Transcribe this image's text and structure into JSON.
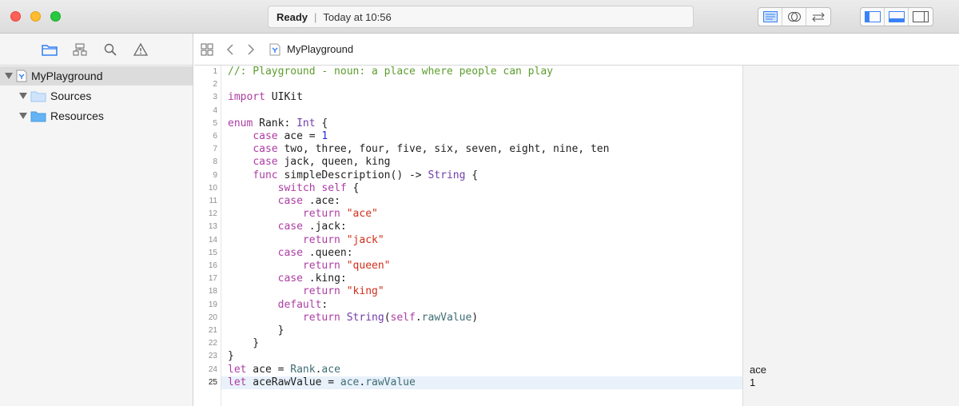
{
  "window": {
    "status": {
      "state": "Ready",
      "separator": "|",
      "time": "Today at 10:56"
    }
  },
  "toolbar": {
    "editor_modes": [
      {
        "icon": "standard-editor-icon"
      },
      {
        "icon": "assistant-editor-icon"
      },
      {
        "icon": "version-editor-icon"
      }
    ],
    "view_toggles": [
      {
        "icon": "navigator-toggle-icon"
      },
      {
        "icon": "debug-area-toggle-icon"
      },
      {
        "icon": "utilities-toggle-icon"
      }
    ]
  },
  "navigator": {
    "tabs": [
      {
        "icon": "folder-icon"
      },
      {
        "icon": "hierarchy-icon"
      },
      {
        "icon": "search-icon"
      },
      {
        "icon": "warning-icon"
      }
    ],
    "tree": [
      {
        "label": "MyPlayground",
        "kind": "playground",
        "selected": true
      },
      {
        "label": "Sources",
        "kind": "folder-light"
      },
      {
        "label": "Resources",
        "kind": "folder"
      }
    ]
  },
  "jumpbar": {
    "file": "MyPlayground"
  },
  "editor": {
    "lines": [
      [
        [
          "com",
          "//: Playground - noun: a place where people can play"
        ]
      ],
      [],
      [
        [
          "kw",
          "import"
        ],
        [
          "",
          " UIKit"
        ]
      ],
      [],
      [
        [
          "kw",
          "enum"
        ],
        [
          "",
          " Rank: "
        ],
        [
          "typ",
          "Int"
        ],
        [
          "",
          " {"
        ]
      ],
      [
        [
          "",
          "    "
        ],
        [
          "kw",
          "case"
        ],
        [
          "",
          " ace = "
        ],
        [
          "num",
          "1"
        ]
      ],
      [
        [
          "",
          "    "
        ],
        [
          "kw",
          "case"
        ],
        [
          "",
          " two, three, four, five, six, seven, eight, nine, ten"
        ]
      ],
      [
        [
          "",
          "    "
        ],
        [
          "kw",
          "case"
        ],
        [
          "",
          " jack, queen, king"
        ]
      ],
      [
        [
          "",
          "    "
        ],
        [
          "kw",
          "func"
        ],
        [
          "",
          " simpleDescription() -> "
        ],
        [
          "typ",
          "String"
        ],
        [
          "",
          " {"
        ]
      ],
      [
        [
          "",
          "        "
        ],
        [
          "kw",
          "switch"
        ],
        [
          "",
          " "
        ],
        [
          "kw",
          "self"
        ],
        [
          "",
          " {"
        ]
      ],
      [
        [
          "",
          "        "
        ],
        [
          "kw",
          "case"
        ],
        [
          "",
          " .ace:"
        ]
      ],
      [
        [
          "",
          "            "
        ],
        [
          "kw",
          "return"
        ],
        [
          "",
          " "
        ],
        [
          "str",
          "\"ace\""
        ]
      ],
      [
        [
          "",
          "        "
        ],
        [
          "kw",
          "case"
        ],
        [
          "",
          " .jack:"
        ]
      ],
      [
        [
          "",
          "            "
        ],
        [
          "kw",
          "return"
        ],
        [
          "",
          " "
        ],
        [
          "str",
          "\"jack\""
        ]
      ],
      [
        [
          "",
          "        "
        ],
        [
          "kw",
          "case"
        ],
        [
          "",
          " .queen:"
        ]
      ],
      [
        [
          "",
          "            "
        ],
        [
          "kw",
          "return"
        ],
        [
          "",
          " "
        ],
        [
          "str",
          "\"queen\""
        ]
      ],
      [
        [
          "",
          "        "
        ],
        [
          "kw",
          "case"
        ],
        [
          "",
          " .king:"
        ]
      ],
      [
        [
          "",
          "            "
        ],
        [
          "kw",
          "return"
        ],
        [
          "",
          " "
        ],
        [
          "str",
          "\"king\""
        ]
      ],
      [
        [
          "",
          "        "
        ],
        [
          "kw",
          "default"
        ],
        [
          "",
          ":"
        ]
      ],
      [
        [
          "",
          "            "
        ],
        [
          "kw",
          "return"
        ],
        [
          "",
          " "
        ],
        [
          "typ",
          "String"
        ],
        [
          "",
          "("
        ],
        [
          "kw",
          "self"
        ],
        [
          "",
          "."
        ],
        [
          "id",
          "rawValue"
        ],
        [
          "",
          ")"
        ]
      ],
      [
        [
          "",
          "        }"
        ]
      ],
      [
        [
          "",
          "    }"
        ]
      ],
      [
        [
          "",
          "}"
        ]
      ],
      [
        [
          "kw",
          "let"
        ],
        [
          "",
          " ace = "
        ],
        [
          "id",
          "Rank"
        ],
        [
          "",
          "."
        ],
        [
          "id",
          "ace"
        ]
      ],
      [
        [
          "kw",
          "let"
        ],
        [
          "",
          " aceRawValue = "
        ],
        [
          "id",
          "ace"
        ],
        [
          "",
          "."
        ],
        [
          "id",
          "rawValue"
        ]
      ]
    ],
    "current_line": 25
  },
  "results": [
    {
      "line": 24,
      "value": "ace"
    },
    {
      "line": 25,
      "value": "1"
    }
  ]
}
